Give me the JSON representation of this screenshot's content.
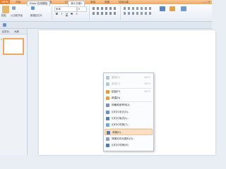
{
  "menubar": {
    "file_label": "WPS",
    "tabs": [
      "开始",
      "插入",
      "设计",
      "切换",
      "幻灯片放映",
      "审阅",
      "视图",
      "特色功能"
    ],
    "window_controls": "— □ ✕"
  },
  "ribbon": {
    "new_slide_label": "新建幻灯片",
    "from_label": "从当前开始",
    "font_name": "宋体",
    "font_size": "0",
    "format_buttons": [
      "B",
      "I",
      "U",
      "S",
      "A"
    ],
    "paste_label": "粘贴"
  },
  "doc_tabs": [
    "Docer-在线模板",
    "演示文稿1"
  ],
  "left_panel": {
    "tabs": [
      "幻灯片",
      "大纲"
    ],
    "slide_number": "1"
  },
  "context_menu": {
    "items": [
      {
        "label": "复制(C)",
        "shortcut": "Ctrl+C",
        "disabled": true,
        "icon_color": "#b9c6d6"
      },
      {
        "label": "剪切(T)",
        "shortcut": "Ctrl+X",
        "disabled": true,
        "icon_color": "#b9c6d6"
      },
      {
        "label": "粘贴(P)",
        "shortcut": "Ctrl+V",
        "disabled": false,
        "icon_color": "#e39a3a"
      },
      {
        "label": "新建(N)",
        "shortcut": "",
        "disabled": false,
        "icon_color": "#d9a441"
      },
      {
        "label": "网格和参考线(I)...",
        "shortcut": "",
        "disabled": false,
        "icon_color": "#7f93ad"
      },
      {
        "label": "幻灯片设计(D)...",
        "shortcut": "",
        "disabled": false,
        "icon_color": "#6b8fc7"
      },
      {
        "label": "幻灯片版式(L)...",
        "shortcut": "",
        "disabled": false,
        "icon_color": "#5b7db8"
      },
      {
        "label": "幻灯片切换(T)...",
        "shortcut": "",
        "disabled": false,
        "icon_color": "#7aa3d6"
      },
      {
        "label": "背景(K)...",
        "shortcut": "",
        "disabled": false,
        "icon_color": "#4f7fc4",
        "highlighted": true
      },
      {
        "label": "背景另存为图片(S)...",
        "shortcut": "",
        "disabled": false,
        "icon_color": "#8ca1bd"
      },
      {
        "label": "幻灯片切换(W)",
        "shortcut": "",
        "disabled": false,
        "icon_color": "#4f78b6"
      }
    ]
  },
  "colors": {
    "accent": "#f0a860",
    "highlight": "#fbe0c4"
  }
}
